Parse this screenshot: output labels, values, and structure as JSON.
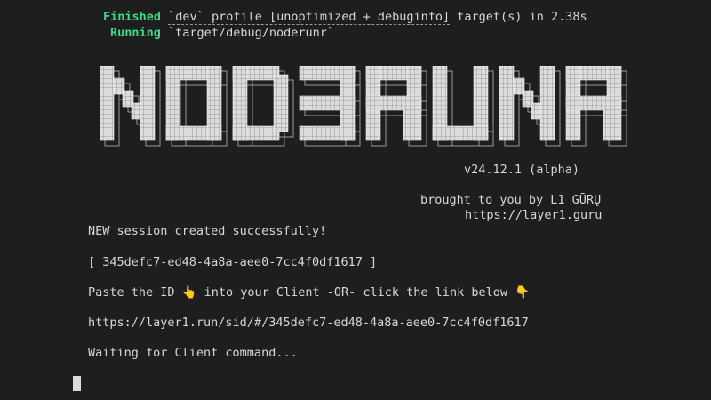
{
  "build": {
    "finished_label": "Finished",
    "finished_profile": "`dev` profile [unoptimized + debuginfo]",
    "finished_rest": " target(s) in 2.38s",
    "running_label": "Running",
    "running_target": "`target/debug/noderunr`"
  },
  "banner": {
    "logo_text": "NODERUNR",
    "version": "v24.12.1 (alpha)",
    "credit": "brought to you by L1 GŪRŲ",
    "url": "https://layer1.guru"
  },
  "session": {
    "created": "NEW session created successfully!",
    "id_line": "[ 345defc7-ed48-4a8a-aee0-7cc4f0df1617 ]",
    "instructions": "Paste the ID 👆 into your Client -OR- click the link below 👇",
    "link": "https://layer1.run/sid/#/345defc7-ed48-4a8a-aee0-7cc4f0df1617",
    "waiting": "Waiting for Client command..."
  },
  "colors": {
    "background": "#1e1e1e",
    "text": "#d8d8d8",
    "accent_green": "#3fd98a"
  }
}
